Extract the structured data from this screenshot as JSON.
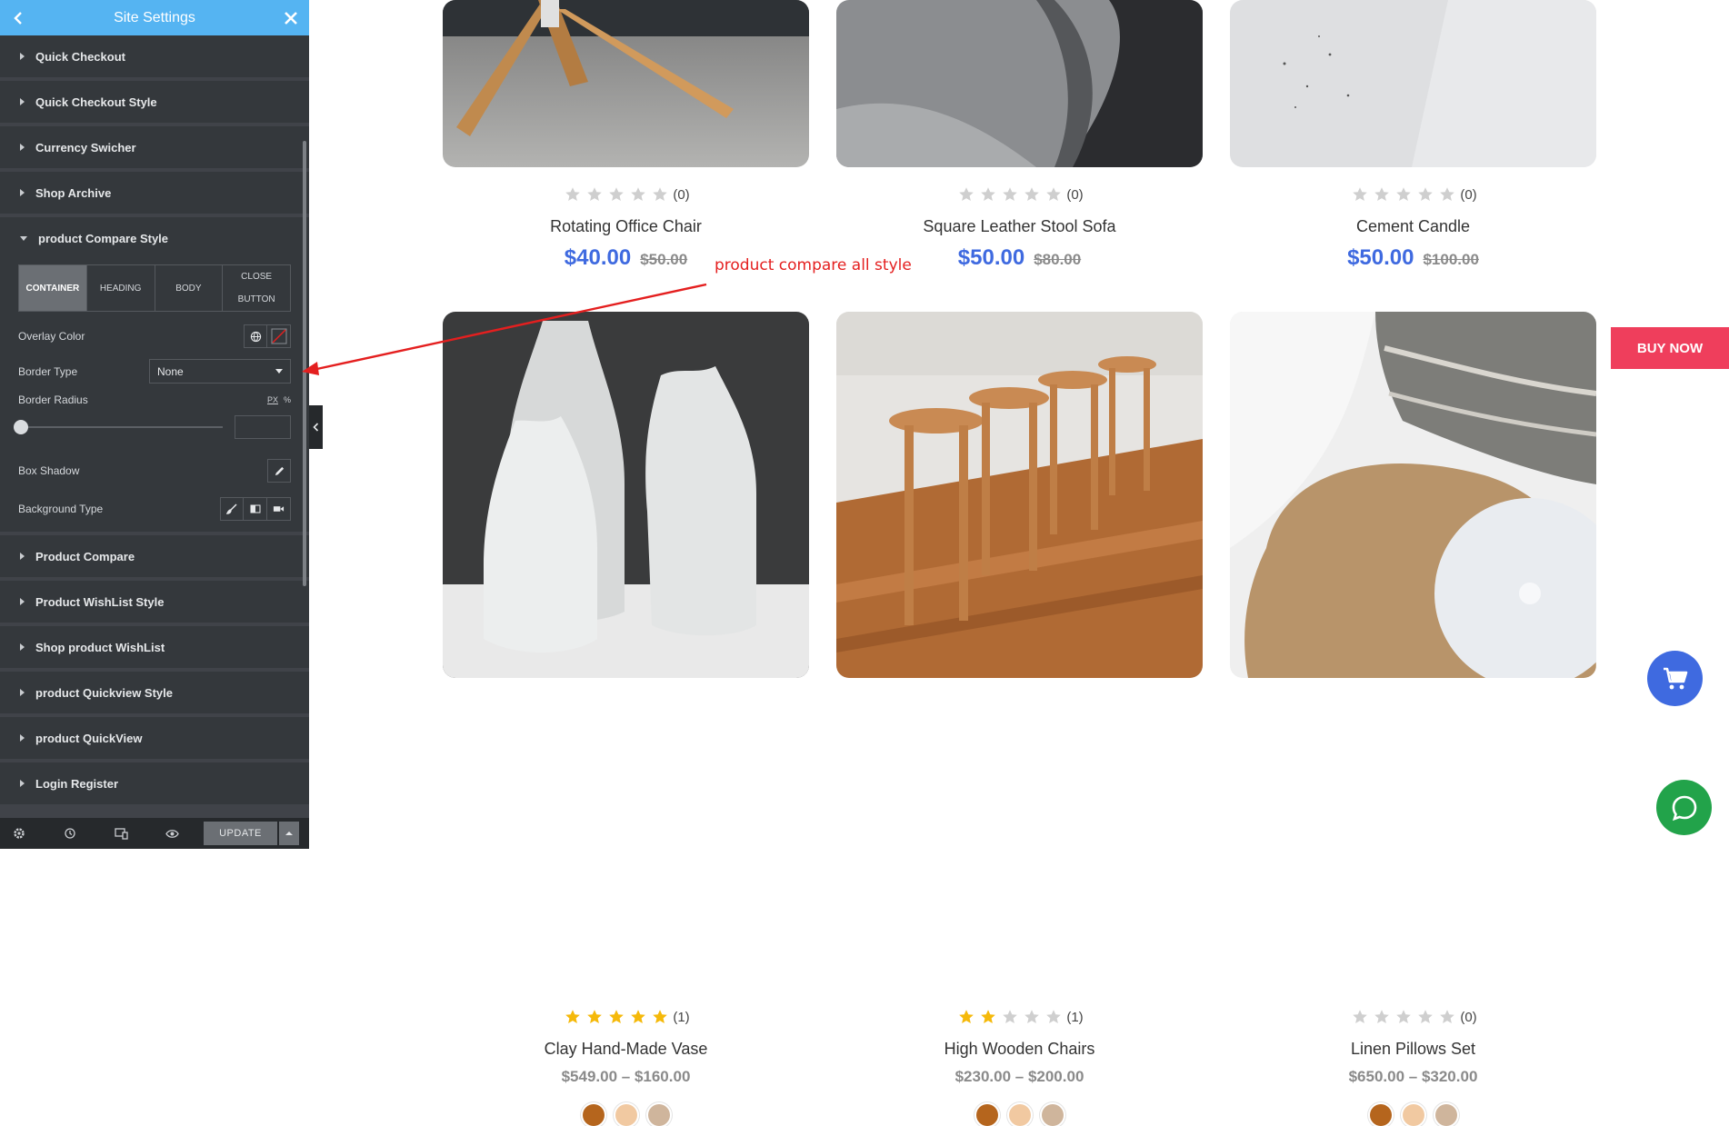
{
  "sidebar": {
    "title": "Site Settings",
    "sections_top": [
      {
        "label": "Quick Checkout"
      },
      {
        "label": "Quick Checkout Style"
      },
      {
        "label": "Currency Swicher"
      },
      {
        "label": "Shop Archive"
      }
    ],
    "open_section": {
      "label": "product Compare Style",
      "tabs": [
        "CONTAINER",
        "HEADING",
        "BODY",
        "CLOSE BUTTON"
      ],
      "active_tab": "CONTAINER",
      "overlay_color_label": "Overlay Color",
      "border_type_label": "Border Type",
      "border_type_value": "None",
      "border_radius_label": "Border Radius",
      "unit_px": "PX",
      "unit_pct": "%",
      "border_radius_value": "",
      "box_shadow_label": "Box Shadow",
      "background_type_label": "Background Type"
    },
    "sections_bottom": [
      {
        "label": "Product Compare"
      },
      {
        "label": "Product WishList Style"
      },
      {
        "label": "Shop product WishList"
      },
      {
        "label": "product Quickview Style"
      },
      {
        "label": "product QuickView"
      },
      {
        "label": "Login Register"
      }
    ],
    "footer": {
      "icons": [
        "gear-icon",
        "history-icon",
        "responsive-icon",
        "eye-icon"
      ],
      "update_label": "UPDATE"
    }
  },
  "annotation": {
    "text": "product compare all style",
    "color": "#e41f1f"
  },
  "products_top": [
    {
      "name": "Rotating Office Chair",
      "rating": 0,
      "review_count": "(0)",
      "price": "$40.00",
      "old_price": "$50.00"
    },
    {
      "name": "Square Leather Stool Sofa",
      "rating": 0,
      "review_count": "(0)",
      "price": "$50.00",
      "old_price": "$80.00"
    },
    {
      "name": "Cement Candle",
      "rating": 0,
      "review_count": "(0)",
      "price": "$50.00",
      "old_price": "$100.00"
    }
  ],
  "products_bottom": [
    {
      "name": "Clay Hand-Made Vase",
      "rating": 5,
      "review_count": "(1)",
      "price_range": "$549.00 – $160.00",
      "swatches": [
        "#b5651d",
        "#f1c9a1",
        "#cfb59c"
      ]
    },
    {
      "name": "High Wooden Chairs",
      "rating": 2,
      "review_count": "(1)",
      "price_range": "$230.00 – $200.00",
      "swatches": [
        "#b5651d",
        "#f1c9a1",
        "#cfb59c"
      ]
    },
    {
      "name": "Linen Pillows Set",
      "rating": 0,
      "review_count": "(0)",
      "price_range": "$650.00 – $320.00",
      "swatches": [
        "#b5651d",
        "#f1c9a1",
        "#cfb59c"
      ]
    }
  ],
  "buy_now_label": "BUY NOW",
  "colors": {
    "accent_blue": "#3f6ae0",
    "sidebar_header": "#55b4f2",
    "buy_now": "#ef3e5c",
    "chat": "#22a34a",
    "star_filled": "#f5b90a",
    "star_empty": "#cfcfcf"
  }
}
